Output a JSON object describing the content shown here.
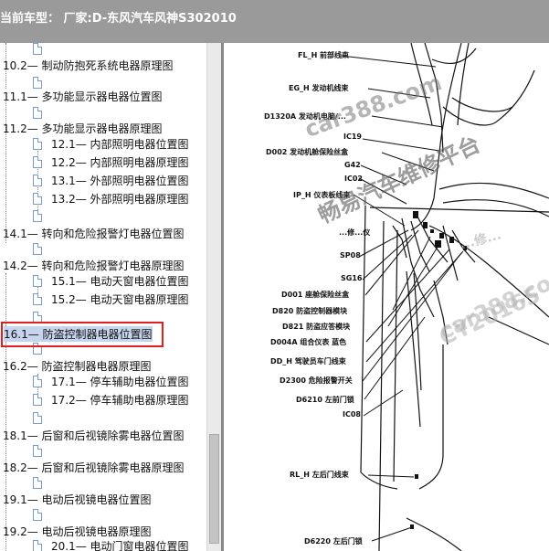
{
  "window": {
    "title": "当前车型：   厂家:D-东风汽车风神S302010"
  },
  "tree": {
    "items": [
      {
        "label": "10.2— 制动防抱死系统电器原理图"
      },
      {
        "label": "11.1— 多功能显示器电器位置图"
      },
      {
        "label": "11.2— 多功能显示器电器原理图"
      },
      {
        "label": "12.1— 内部照明电器位置图"
      },
      {
        "label": "12.2— 内部照明电器原理图"
      },
      {
        "label": "13.1— 外部照明电器位置图"
      },
      {
        "label": "13.2— 外部照明电器原理图"
      },
      {
        "label": "14.1— 转向和危险报警灯电器位置图"
      },
      {
        "label": "14.2— 转向和危险报警灯电器原理图"
      },
      {
        "label": "15.1— 电动天窗电器位置图"
      },
      {
        "label": "15.2— 电动天窗电器原理图"
      },
      {
        "label": "16.1— 防盗控制器电器位置图"
      },
      {
        "label": "16.2— 防盗控制器电器原理图"
      },
      {
        "label": "17.1— 停车辅助电器位置图"
      },
      {
        "label": "17.2— 停车辅助电器原理图"
      },
      {
        "label": "18.1— 后窗和后视镜除雾电器位置图"
      },
      {
        "label": "18.2— 后窗和后视镜除雾电器原理图"
      },
      {
        "label": "19.1— 电动后视镜电器位置图"
      },
      {
        "label": "19.2— 电动后视镜电器原理图"
      },
      {
        "label": "20.1— 电动门窗电器位置图"
      }
    ]
  },
  "diagram": {
    "labels": [
      "FL_H  前部线束",
      "EG_H  发动机线束",
      "D1320A 发动机电脑/...",
      "IC19",
      "D002 发动机舱保险丝盒",
      "G42",
      "IC02",
      "IP_H  仪表板线束",
      "...修...仪",
      "SP08",
      "SG16",
      "D001  座舱保险丝盒",
      "D820  防盗控制器模块",
      "D821  防盗应答模块",
      "D004A  组合仪表  蓝色",
      "DD_H  驾驶员车门线束",
      "D2300  危险报警开关",
      "D6210  左前门锁",
      "IC08",
      "RL_H  左后门线束",
      "D6220  左后门锁"
    ],
    "watermarks": [
      "car388.com",
      "畅易汽车维修平台",
      "...修...",
      "car388.com",
      "CY20165"
    ]
  }
}
